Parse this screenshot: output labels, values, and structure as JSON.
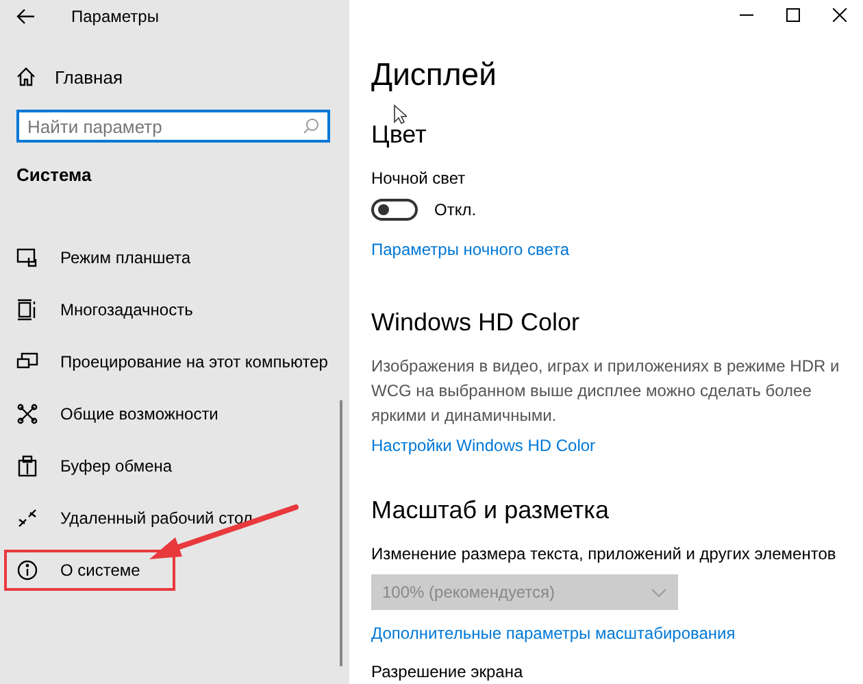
{
  "window": {
    "title": "Параметры"
  },
  "sidebar": {
    "home": "Главная",
    "search": {
      "placeholder": "Найти параметр"
    },
    "section": "Система",
    "items": [
      {
        "label": "Режим планшета",
        "highlighted": false
      },
      {
        "label": "Многозадачность",
        "highlighted": false
      },
      {
        "label": "Проецирование на этот компьютер",
        "highlighted": false
      },
      {
        "label": "Общие возможности",
        "highlighted": false
      },
      {
        "label": "Буфер обмена",
        "highlighted": false
      },
      {
        "label": "Удаленный рабочий стол",
        "highlighted": false
      },
      {
        "label": "О системе",
        "highlighted": true
      }
    ]
  },
  "content": {
    "title": "Дисплей",
    "color": {
      "heading": "Цвет",
      "night_light": {
        "label": "Ночной свет",
        "on": false,
        "state_text": "Откл."
      },
      "link": "Параметры ночного света"
    },
    "hd_color": {
      "heading": "Windows HD Color",
      "description": "Изображения в видео, играх и приложениях в режиме HDR и WCG на выбранном выше дисплее можно сделать более яркими и динамичными.",
      "link": "Настройки Windows HD Color"
    },
    "scale": {
      "heading": "Масштаб и разметка",
      "label": "Изменение размера текста, приложений и других элементов",
      "dropdown": {
        "value": "100% (рекомендуется)",
        "disabled": true
      },
      "link": "Дополнительные параметры масштабирования",
      "resolution_label": "Разрешение экрана"
    }
  }
}
